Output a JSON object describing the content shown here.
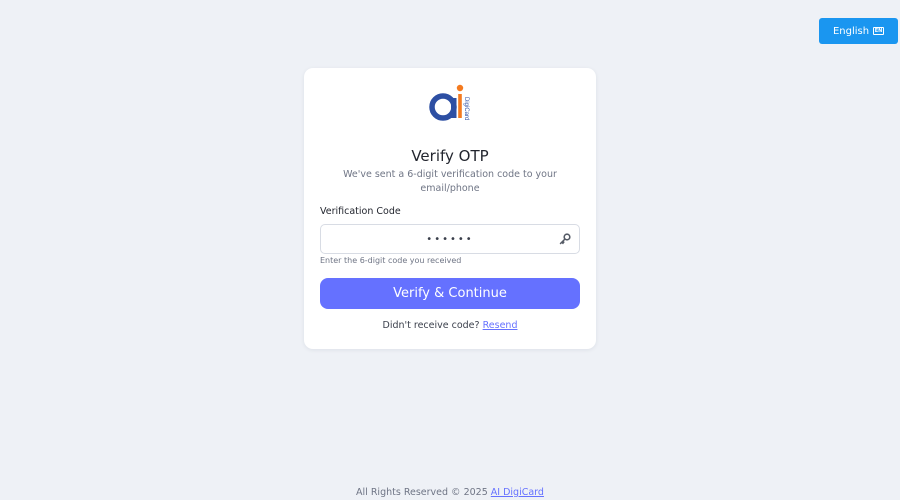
{
  "header": {
    "language_label": "English",
    "language_flag": "EN"
  },
  "brand": {
    "logo_text": "DigiCard",
    "colors": {
      "primary": "#2d4fa3",
      "accent": "#f47a1f"
    }
  },
  "card": {
    "title": "Verify OTP",
    "subtitle": "We've sent a 6-digit verification code to your email/phone",
    "field_label": "Verification Code",
    "otp_value": "••••••",
    "helper_text": "Enter the 6-digit code you received",
    "verify_button_label": "Verify & Continue",
    "resend_prompt": "Didn't receive code?",
    "resend_link": "Resend"
  },
  "footer": {
    "copyright": "All Rights Reserved © 2025",
    "company_link": "AI DigiCard"
  },
  "colors": {
    "background": "#eef1f6",
    "button": "#6571ff",
    "language_button": "#1a96f0"
  }
}
